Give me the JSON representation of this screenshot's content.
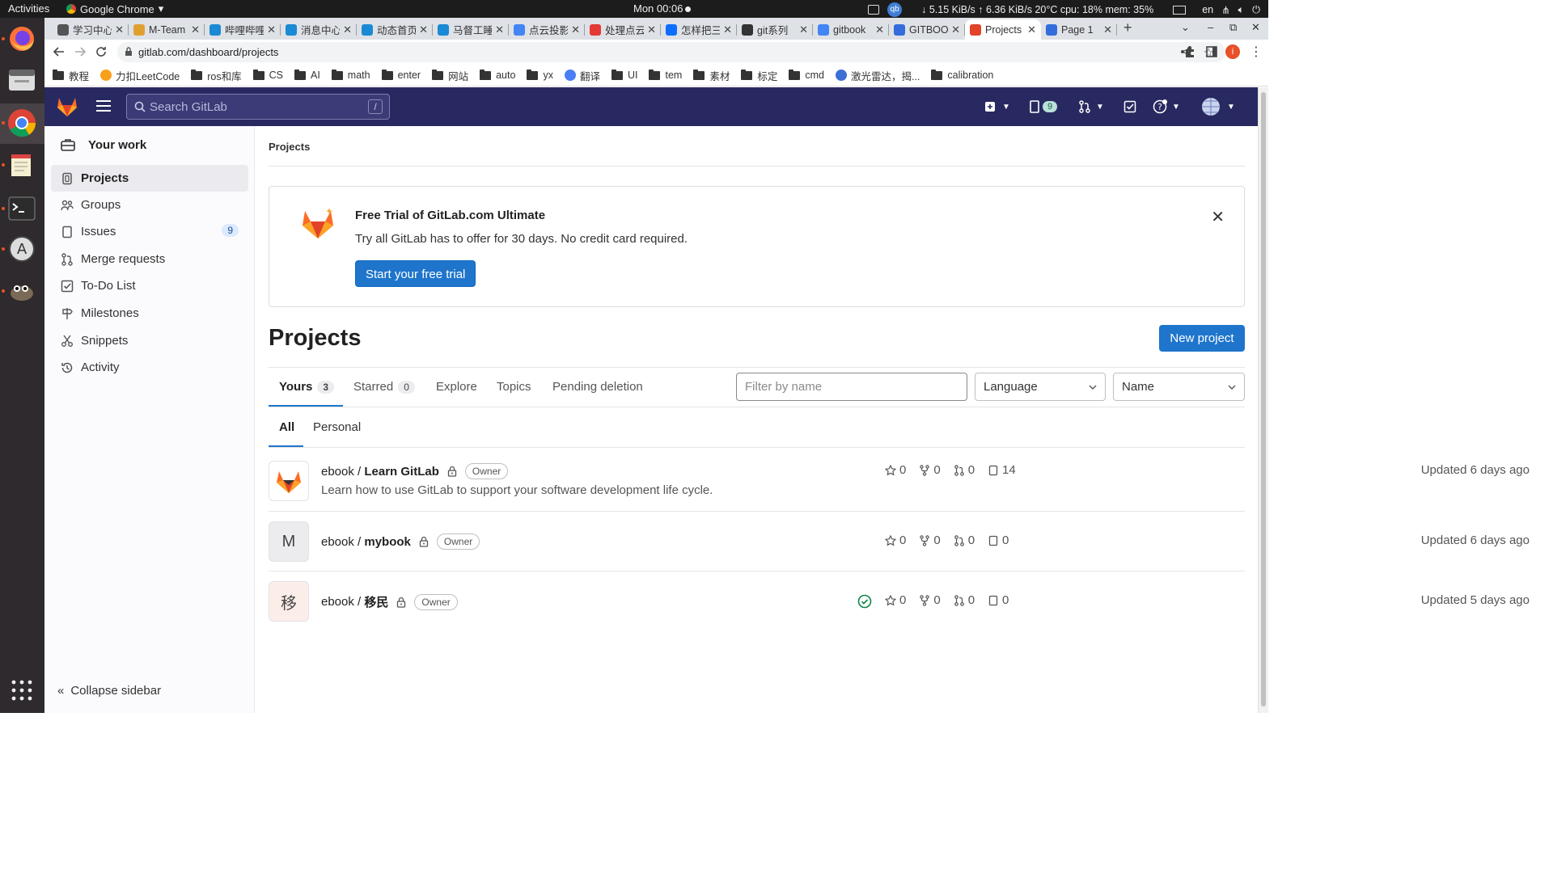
{
  "os": {
    "activities": "Activities",
    "app_name": "Google Chrome",
    "clock": "Mon 00:06",
    "net_stats": "↓ 5.15 KiB/s ↑ 6.36 KiB/s 20°C cpu: 18% mem: 35%",
    "lang": "en"
  },
  "browser": {
    "tabs": [
      {
        "title": "学习中心",
        "color": "#555"
      },
      {
        "title": "M-Team",
        "color": "#e0a030"
      },
      {
        "title": "哔哩哔哩",
        "color": "#1a8ad4"
      },
      {
        "title": "消息中心",
        "color": "#1a8ad4"
      },
      {
        "title": "动态首页",
        "color": "#1a8ad4"
      },
      {
        "title": "马督工睡",
        "color": "#1a8ad4"
      },
      {
        "title": "点云投影",
        "color": "#4285f4"
      },
      {
        "title": "处理点云",
        "color": "#e53935"
      },
      {
        "title": "怎样把三",
        "color": "#0d6efd"
      },
      {
        "title": "git系列",
        "color": "#333"
      },
      {
        "title": "gitbook",
        "color": "#4285f4"
      },
      {
        "title": "GITBOOK",
        "color": "#346ddb"
      },
      {
        "title": "Projects",
        "color": "#e24329"
      },
      {
        "title": "Page 1",
        "color": "#346ddb"
      }
    ],
    "url": "gitlab.com/dashboard/projects",
    "bookmarks": [
      {
        "label": "教程",
        "type": "folder"
      },
      {
        "label": "力扣LeetCode",
        "type": "site"
      },
      {
        "label": "ros和库",
        "type": "folder"
      },
      {
        "label": "CS",
        "type": "folder"
      },
      {
        "label": "AI",
        "type": "folder"
      },
      {
        "label": "math",
        "type": "folder"
      },
      {
        "label": "enter",
        "type": "folder"
      },
      {
        "label": "网站",
        "type": "folder"
      },
      {
        "label": "auto",
        "type": "folder"
      },
      {
        "label": "yx",
        "type": "folder"
      },
      {
        "label": "翻译",
        "type": "site"
      },
      {
        "label": "UI",
        "type": "folder"
      },
      {
        "label": "tem",
        "type": "folder"
      },
      {
        "label": "素材",
        "type": "folder"
      },
      {
        "label": "标定",
        "type": "folder"
      },
      {
        "label": "cmd",
        "type": "folder"
      },
      {
        "label": "激光雷达，揭...",
        "type": "site"
      },
      {
        "label": "calibration",
        "type": "folder"
      }
    ]
  },
  "gitlab": {
    "search_placeholder": "Search GitLab",
    "search_shortcut": "/",
    "issues_badge": "9",
    "sidebar": {
      "heading": "Your work",
      "items": [
        {
          "label": "Projects",
          "icon": "project-icon"
        },
        {
          "label": "Groups",
          "icon": "group-icon"
        },
        {
          "label": "Issues",
          "icon": "issues-icon",
          "count": "9"
        },
        {
          "label": "Merge requests",
          "icon": "merge-request-icon"
        },
        {
          "label": "To-Do List",
          "icon": "todo-icon"
        },
        {
          "label": "Milestones",
          "icon": "milestone-icon"
        },
        {
          "label": "Snippets",
          "icon": "snippet-icon"
        },
        {
          "label": "Activity",
          "icon": "history-icon"
        }
      ],
      "collapse": "Collapse sidebar"
    },
    "breadcrumb": "Projects",
    "trial": {
      "title": "Free Trial of GitLab.com Ultimate",
      "text": "Try all GitLab has to offer for 30 days. No credit card required.",
      "button": "Start your free trial"
    },
    "page_title": "Projects",
    "new_project": "New project",
    "tabs": [
      {
        "label": "Yours",
        "count": "3"
      },
      {
        "label": "Starred",
        "count": "0"
      },
      {
        "label": "Explore"
      },
      {
        "label": "Topics"
      },
      {
        "label": "Pending deletion"
      }
    ],
    "filter_placeholder": "Filter by name",
    "language_select": "Language",
    "sort_select": "Name",
    "subtabs": [
      "All",
      "Personal"
    ],
    "projects": [
      {
        "namespace": "ebook / ",
        "name": "Learn GitLab",
        "role": "Owner",
        "description": "Learn how to use GitLab to support your software development life cycle.",
        "avatar": "",
        "stars": "0",
        "forks": "0",
        "mrs": "0",
        "issues": "14",
        "updated": "Updated 6 days ago",
        "pipeline": false
      },
      {
        "namespace": "ebook / ",
        "name": "mybook",
        "role": "Owner",
        "description": "",
        "avatar": "M",
        "stars": "0",
        "forks": "0",
        "mrs": "0",
        "issues": "0",
        "updated": "Updated 6 days ago",
        "pipeline": false
      },
      {
        "namespace": "ebook / ",
        "name": "移民",
        "role": "Owner",
        "description": "",
        "avatar": "移",
        "stars": "0",
        "forks": "0",
        "mrs": "0",
        "issues": "0",
        "updated": "Updated 5 days ago",
        "pipeline": true
      }
    ]
  }
}
